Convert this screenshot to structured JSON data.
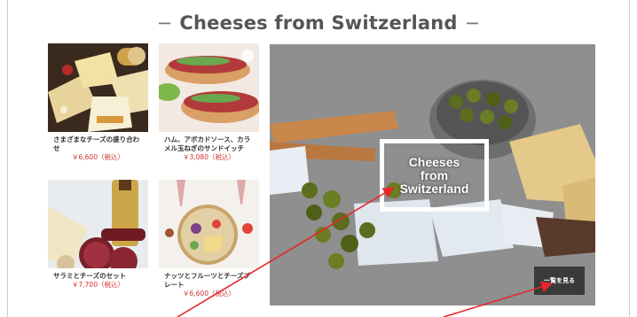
{
  "section": {
    "title": "Cheeses from Switzerland",
    "dash_left": "−",
    "dash_right": "−"
  },
  "products": [
    {
      "name": "さまざまなチーズの盛り合わせ",
      "price": "￥6,600（税込）"
    },
    {
      "name": "ハム、アボカドソース、カラメル玉ねぎのサンドイッチ",
      "price": "￥3,080（税込）"
    },
    {
      "name": "サラミとチーズのセット",
      "price": "￥7,700（税込）"
    },
    {
      "name": "ナッツとフルーツとチーズプレート",
      "price": "￥6,600（税込）"
    }
  ],
  "hero": {
    "badge_text": "Cheeses\nfrom\nSwitzerland",
    "view_button_label": "一覧を見る"
  },
  "colors": {
    "price": "#d0312d",
    "button_bg": "#3a3a3a",
    "annotation_arrow": "#e8262a"
  }
}
